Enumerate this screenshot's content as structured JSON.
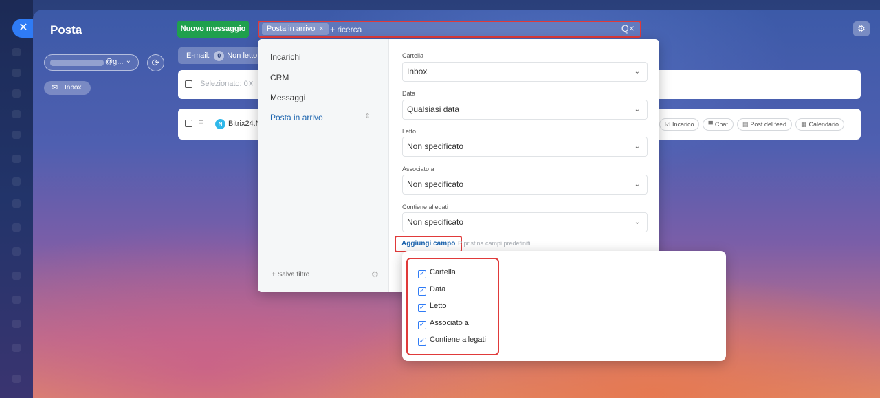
{
  "window": {
    "title": "Posta",
    "close_icon": "close-icon"
  },
  "account": {
    "email_suffix": "@g...",
    "chevron": "chevron-down-icon"
  },
  "folder_chip": {
    "label": "Inbox",
    "icon": "envelope-icon"
  },
  "toolbar": {
    "new_message_label": "Nuovo messaggio",
    "search": {
      "tag_label": "Posta in arrivo",
      "tag_remove": "×",
      "placeholder": "+ ricerca",
      "icons": "Q×"
    },
    "settings_icon": "gear-icon"
  },
  "counters": {
    "email_label": "E-mail:",
    "count": "0",
    "unread_label": "Non letto"
  },
  "selection_row": {
    "label": "Selezionato: 0",
    "clear": "×"
  },
  "message_row": {
    "avatar_letter": "N",
    "sender": "Bitrix24.N",
    "actions": [
      {
        "icon": "☑",
        "label": "Incarico"
      },
      {
        "icon": "▀",
        "label": "Chat"
      },
      {
        "icon": "▤",
        "label": "Post del feed"
      },
      {
        "icon": "▦",
        "label": "Calendario"
      }
    ]
  },
  "filter": {
    "presets": [
      {
        "label": "Incarichi"
      },
      {
        "label": "CRM"
      },
      {
        "label": "Messaggi"
      },
      {
        "label": "Posta in arrivo"
      }
    ],
    "save_filter": "+ Salva filtro",
    "fields": [
      {
        "label": "Cartella",
        "value": "Inbox"
      },
      {
        "label": "Data",
        "value": "Qualsiasi data"
      },
      {
        "label": "Letto",
        "value": "Non specificato"
      },
      {
        "label": "Associato a",
        "value": "Non specificato"
      },
      {
        "label": "Contiene allegati",
        "value": "Non specificato"
      }
    ],
    "add_field_label": "Aggiungi campo",
    "reset_fields_label": "Ripristina campi predefiniti"
  },
  "field_options": [
    {
      "label": "Cartella",
      "checked": true
    },
    {
      "label": "Data",
      "checked": true
    },
    {
      "label": "Letto",
      "checked": true
    },
    {
      "label": "Associato a",
      "checked": true
    },
    {
      "label": "Contiene allegati",
      "checked": true
    }
  ],
  "colors": {
    "accent": "#2f7bf5",
    "success": "#1fa04d",
    "highlight": "#e03a3a",
    "link": "#2067b0"
  }
}
